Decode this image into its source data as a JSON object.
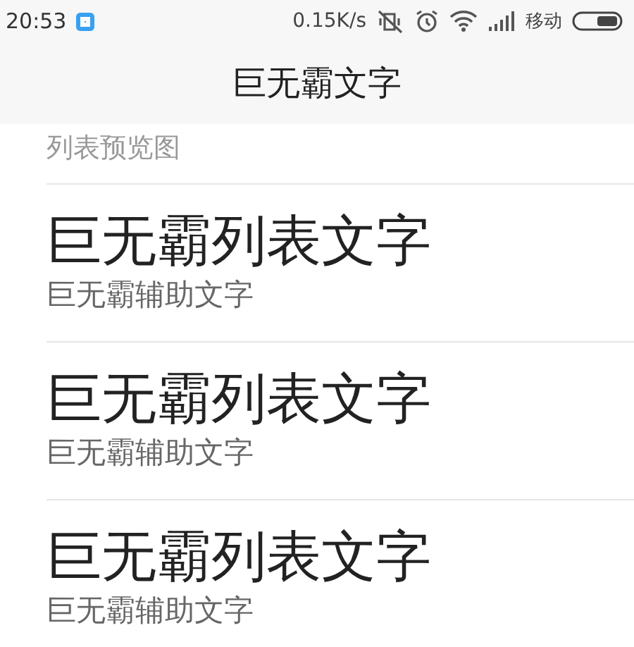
{
  "status_bar": {
    "time": "20:53",
    "speed": "0.15K/s",
    "carrier": "移动"
  },
  "header": {
    "title": "巨无霸文字"
  },
  "section": {
    "label": "列表预览图"
  },
  "items": [
    {
      "title": "巨无霸列表文字",
      "subtitle": "巨无霸辅助文字"
    },
    {
      "title": "巨无霸列表文字",
      "subtitle": "巨无霸辅助文字"
    },
    {
      "title": "巨无霸列表文字",
      "subtitle": "巨无霸辅助文字"
    }
  ]
}
